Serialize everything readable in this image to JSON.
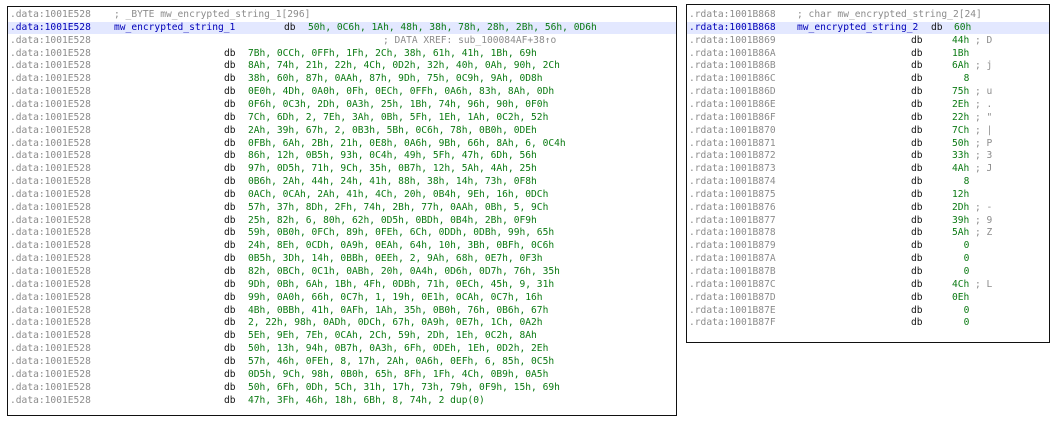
{
  "left_panel": {
    "header": {
      "addr": ".data:1001E528",
      "comment": "; _BYTE mw_encrypted_string_1[296]"
    },
    "label_row": {
      "addr": ".data:1001E528",
      "label": "mw_encrypted_string_1",
      "directive": "db",
      "value": "50h, 0C6h, 1Ah, 48h, 38h, 78h, 28h, 2Bh, 56h, 0D6h"
    },
    "xref_row": {
      "addr": ".data:1001E528",
      "comment": "; DATA XREF: sub_100084AF+38↑o"
    },
    "rows": [
      {
        "addr": ".data:1001E528",
        "directive": "db",
        "value": "7Bh, 0CCh, 0FFh, 1Fh, 2Ch, 38h, 61h, 41h, 1Bh, 69h"
      },
      {
        "addr": ".data:1001E528",
        "directive": "db",
        "value": "8Ah, 74h, 21h, 22h, 4Ch, 0D2h, 32h, 40h, 0Ah, 90h, 2Ch"
      },
      {
        "addr": ".data:1001E528",
        "directive": "db",
        "value": "38h, 60h, 87h, 0AAh, 87h, 9Dh, 75h, 0C9h, 9Ah, 0D8h"
      },
      {
        "addr": ".data:1001E528",
        "directive": "db",
        "value": "0E0h, 4Dh, 0A0h, 0Fh, 0ECh, 0FFh, 0A6h, 83h, 8Ah, 0Dh"
      },
      {
        "addr": ".data:1001E528",
        "directive": "db",
        "value": "0F6h, 0C3h, 2Dh, 0A3h, 25h, 1Bh, 74h, 96h, 90h, 0F0h"
      },
      {
        "addr": ".data:1001E528",
        "directive": "db",
        "value": "7Ch, 6Dh, 2, 7Eh, 3Ah, 0Bh, 5Fh, 1Eh, 1Ah, 0C2h, 52h"
      },
      {
        "addr": ".data:1001E528",
        "directive": "db",
        "value": "2Ah, 39h, 67h, 2, 0B3h, 5Bh, 0C6h, 78h, 0B0h, 0DEh"
      },
      {
        "addr": ".data:1001E528",
        "directive": "db",
        "value": "0FBh, 6Ah, 2Bh, 21h, 0E8h, 0A6h, 9Bh, 66h, 8Ah, 6, 0C4h"
      },
      {
        "addr": ".data:1001E528",
        "directive": "db",
        "value": "86h, 12h, 0B5h, 93h, 0C4h, 49h, 5Fh, 47h, 6Dh, 56h"
      },
      {
        "addr": ".data:1001E528",
        "directive": "db",
        "value": "97h, 0D5h, 71h, 9Ch, 35h, 0B7h, 12h, 5Ah, 4Ah, 25h"
      },
      {
        "addr": ".data:1001E528",
        "directive": "db",
        "value": "0B6h, 2Ah, 44h, 24h, 41h, 88h, 38h, 14h, 73h, 0F8h"
      },
      {
        "addr": ".data:1001E528",
        "directive": "db",
        "value": "0ACh, 0CAh, 2Ah, 41h, 4Ch, 20h, 0B4h, 9Eh, 16h, 0DCh"
      },
      {
        "addr": ".data:1001E528",
        "directive": "db",
        "value": "57h, 37h, 8Dh, 2Fh, 74h, 2Bh, 77h, 0AAh, 0Bh, 5, 9Ch"
      },
      {
        "addr": ".data:1001E528",
        "directive": "db",
        "value": "25h, 82h, 6, 80h, 62h, 0D5h, 0BDh, 0B4h, 2Bh, 0F9h"
      },
      {
        "addr": ".data:1001E528",
        "directive": "db",
        "value": "59h, 0B0h, 0FCh, 89h, 0FEh, 6Ch, 0DDh, 0DBh, 99h, 65h"
      },
      {
        "addr": ".data:1001E528",
        "directive": "db",
        "value": "24h, 8Eh, 0CDh, 0A9h, 0EAh, 64h, 10h, 3Bh, 0BFh, 0C6h"
      },
      {
        "addr": ".data:1001E528",
        "directive": "db",
        "value": "0B5h, 3Dh, 14h, 0BBh, 0EEh, 2, 9Ah, 68h, 0E7h, 0F3h"
      },
      {
        "addr": ".data:1001E528",
        "directive": "db",
        "value": "82h, 0BCh, 0C1h, 0ABh, 20h, 0A4h, 0D6h, 0D7h, 76h, 35h"
      },
      {
        "addr": ".data:1001E528",
        "directive": "db",
        "value": "9Dh, 0Bh, 6Ah, 1Bh, 4Fh, 0DBh, 71h, 0ECh, 45h, 9, 31h"
      },
      {
        "addr": ".data:1001E528",
        "directive": "db",
        "value": "99h, 0A0h, 66h, 0C7h, 1, 19h, 0E1h, 0CAh, 0C7h, 16h"
      },
      {
        "addr": ".data:1001E528",
        "directive": "db",
        "value": "4Bh, 0BBh, 41h, 0AFh, 1Ah, 35h, 0B0h, 76h, 0B6h, 67h"
      },
      {
        "addr": ".data:1001E528",
        "directive": "db",
        "value": "2, 22h, 98h, 0ADh, 0DCh, 67h, 0A9h, 0E7h, 1Ch, 0A2h"
      },
      {
        "addr": ".data:1001E528",
        "directive": "db",
        "value": "5Eh, 9Eh, 7Eh, 0CAh, 2Ch, 59h, 2Dh, 1Eh, 0C2h, 8Ah"
      },
      {
        "addr": ".data:1001E528",
        "directive": "db",
        "value": "50h, 13h, 94h, 0B7h, 0A3h, 6Fh, 0DEh, 1Eh, 0D2h, 2Eh"
      },
      {
        "addr": ".data:1001E528",
        "directive": "db",
        "value": "57h, 46h, 0FEh, 8, 17h, 2Ah, 0A6h, 0EFh, 6, 85h, 0C5h"
      },
      {
        "addr": ".data:1001E528",
        "directive": "db",
        "value": "0D5h, 9Ch, 98h, 0B0h, 65h, 8Fh, 1Fh, 4Ch, 0B9h, 0A5h"
      },
      {
        "addr": ".data:1001E528",
        "directive": "db",
        "value": "50h, 6Fh, 0Dh, 5Ch, 31h, 17h, 73h, 79h, 0F9h, 15h, 69h"
      },
      {
        "addr": ".data:1001E528",
        "directive": "db",
        "value": "47h, 3Fh, 46h, 18h, 6Bh, 8, 74h, 2 dup(0)"
      }
    ]
  },
  "right_panel": {
    "header": {
      "addr": ".rdata:1001B868",
      "comment": "; char mw_encrypted_string_2[24]"
    },
    "label_row": {
      "addr": ".rdata:1001B868",
      "label": "mw_encrypted_string_2",
      "directive": "db",
      "value": "60h"
    },
    "rows": [
      {
        "addr": ".rdata:1001B869",
        "directive": "db",
        "value": "44h",
        "char": "; D"
      },
      {
        "addr": ".rdata:1001B86A",
        "directive": "db",
        "value": "1Bh",
        "char": ""
      },
      {
        "addr": ".rdata:1001B86B",
        "directive": "db",
        "value": "6Ah",
        "char": "; j"
      },
      {
        "addr": ".rdata:1001B86C",
        "directive": "db",
        "value": "8",
        "char": ""
      },
      {
        "addr": ".rdata:1001B86D",
        "directive": "db",
        "value": "75h",
        "char": "; u"
      },
      {
        "addr": ".rdata:1001B86E",
        "directive": "db",
        "value": "2Eh",
        "char": "; ."
      },
      {
        "addr": ".rdata:1001B86F",
        "directive": "db",
        "value": "22h",
        "char": "; \""
      },
      {
        "addr": ".rdata:1001B870",
        "directive": "db",
        "value": "7Ch",
        "char": "; |"
      },
      {
        "addr": ".rdata:1001B871",
        "directive": "db",
        "value": "50h",
        "char": "; P"
      },
      {
        "addr": ".rdata:1001B872",
        "directive": "db",
        "value": "33h",
        "char": "; 3"
      },
      {
        "addr": ".rdata:1001B873",
        "directive": "db",
        "value": "4Ah",
        "char": "; J"
      },
      {
        "addr": ".rdata:1001B874",
        "directive": "db",
        "value": "8",
        "char": ""
      },
      {
        "addr": ".rdata:1001B875",
        "directive": "db",
        "value": "12h",
        "char": ""
      },
      {
        "addr": ".rdata:1001B876",
        "directive": "db",
        "value": "2Dh",
        "char": "; -"
      },
      {
        "addr": ".rdata:1001B877",
        "directive": "db",
        "value": "39h",
        "char": "; 9"
      },
      {
        "addr": ".rdata:1001B878",
        "directive": "db",
        "value": "5Ah",
        "char": "; Z"
      },
      {
        "addr": ".rdata:1001B879",
        "directive": "db",
        "value": "0",
        "char": ""
      },
      {
        "addr": ".rdata:1001B87A",
        "directive": "db",
        "value": "0",
        "char": ""
      },
      {
        "addr": ".rdata:1001B87B",
        "directive": "db",
        "value": "0",
        "char": ""
      },
      {
        "addr": ".rdata:1001B87C",
        "directive": "db",
        "value": "4Ch",
        "char": "; L"
      },
      {
        "addr": ".rdata:1001B87D",
        "directive": "db",
        "value": "0Eh",
        "char": ""
      },
      {
        "addr": ".rdata:1001B87E",
        "directive": "db",
        "value": "0",
        "char": ""
      },
      {
        "addr": ".rdata:1001B87F",
        "directive": "db",
        "value": "0",
        "char": ""
      }
    ]
  }
}
